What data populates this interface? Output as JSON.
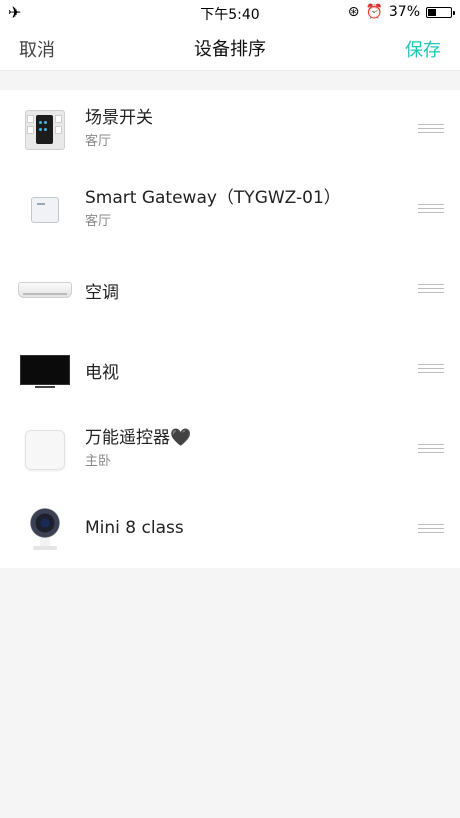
{
  "status_bar": {
    "airplane_icon": "airplane-icon",
    "time": "下午5:40",
    "battery_percent": "37%",
    "battery_level": 0.37
  },
  "nav": {
    "cancel_label": "取消",
    "title": "设备排序",
    "save_label": "保存"
  },
  "colors": {
    "accent": "#1ec7b6",
    "background": "#f5f5f5",
    "row_bg": "#ffffff"
  },
  "devices": [
    {
      "name": "场景开关",
      "room": "客厅",
      "icon": "scene-switch-panel-icon"
    },
    {
      "name": "Smart Gateway（TYGWZ-01）",
      "room": "客厅",
      "icon": "gateway-icon"
    },
    {
      "name": "空调",
      "room": "",
      "icon": "air-conditioner-icon"
    },
    {
      "name": "电视",
      "room": "",
      "icon": "tv-icon"
    },
    {
      "name": "万能遥控器🖤",
      "room": "主卧",
      "icon": "remote-hub-icon"
    },
    {
      "name": "Mini 8 class",
      "room": "",
      "icon": "camera-icon"
    }
  ]
}
